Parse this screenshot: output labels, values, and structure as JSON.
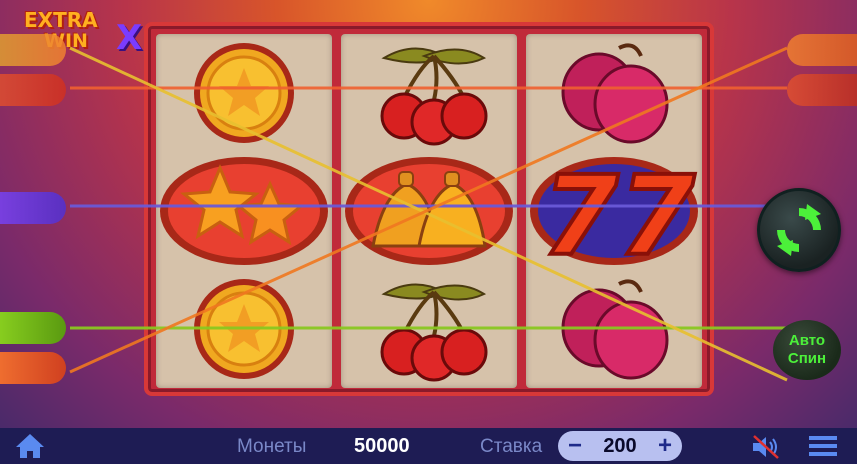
{
  "game": {
    "logo_line1": "EXTRA",
    "logo_line2": "WIN",
    "logo_x": "X"
  },
  "reels": [
    [
      "coin-star",
      "stars",
      "coin-star"
    ],
    [
      "cherries",
      "bells",
      "cherries"
    ],
    [
      "plums",
      "sevens",
      "plums"
    ]
  ],
  "controls": {
    "auto_spin_line1": "Авто",
    "auto_spin_line2": "Спин"
  },
  "bottom_bar": {
    "coins_label": "Монеты",
    "coins_value": "50000",
    "bet_label": "Ставка",
    "bet_minus": "−",
    "bet_value": "200",
    "bet_plus": "+"
  },
  "colors": {
    "payline_red": "#f0602a",
    "payline_blue": "#6a5ad8",
    "payline_green": "#8ac820",
    "payline_gold": "#e8c030",
    "payline_orange": "#f07820",
    "spin_green": "#4cf03a"
  }
}
